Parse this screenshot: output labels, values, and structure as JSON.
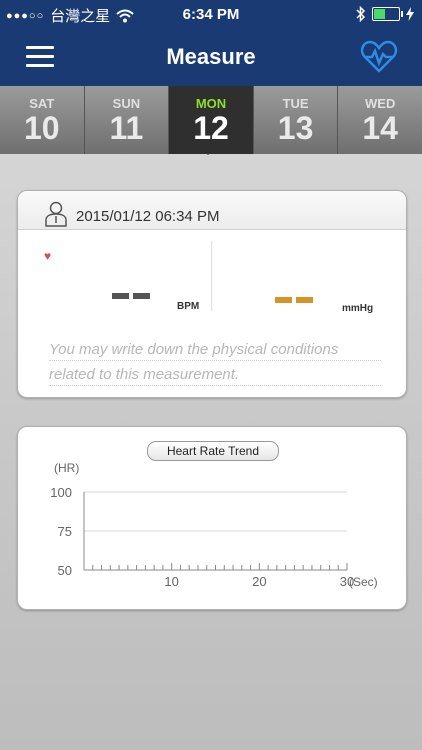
{
  "status": {
    "signal": "●●●○○",
    "carrier": "台灣之星",
    "time": "6:34 PM",
    "battery_fraction": 0.45
  },
  "nav": {
    "title": "Measure"
  },
  "days": [
    {
      "name": "SAT",
      "num": "10"
    },
    {
      "name": "SUN",
      "num": "11"
    },
    {
      "name": "MON",
      "num": "12"
    },
    {
      "name": "TUE",
      "num": "13"
    },
    {
      "name": "WED",
      "num": "14"
    }
  ],
  "measure": {
    "timestamp": "2015/01/12 06:34 PM",
    "bpm_unit": "BPM",
    "bp_unit": "mmHg",
    "note_line1": "You may write down the physical conditions",
    "note_line2": "related to this measurement."
  },
  "chart_data": {
    "type": "line",
    "title": "Heart Rate Trend",
    "ylabel": "(HR)",
    "xlabel": "(Sec)",
    "x_ticks": [
      "10",
      "20",
      "30"
    ],
    "y_ticks": [
      "100",
      "75",
      "50"
    ],
    "xlim": [
      0,
      30
    ],
    "ylim": [
      50,
      100
    ],
    "series": []
  }
}
